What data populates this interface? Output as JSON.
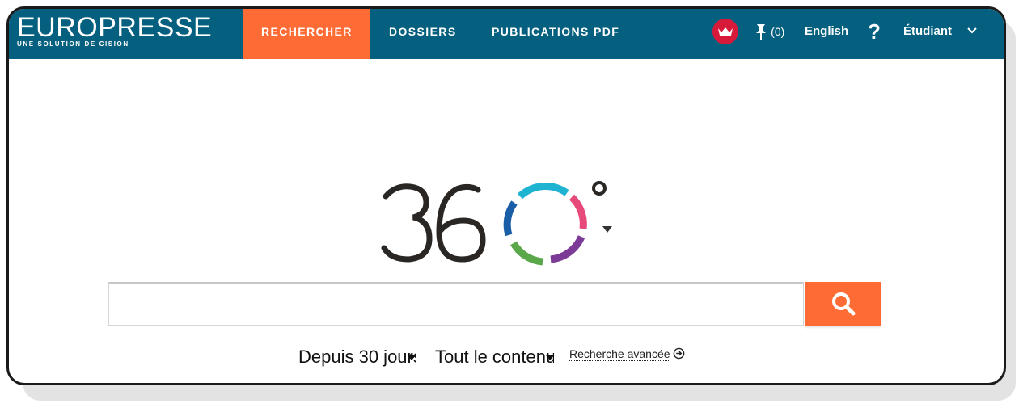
{
  "brand": {
    "name": "EUROPRESSE",
    "tagline": "UNE SOLUTION DE CISION"
  },
  "nav": [
    {
      "label": "RECHERCHER",
      "active": true
    },
    {
      "label": "DOSSIERS",
      "active": false
    },
    {
      "label": "PUBLICATIONS PDF",
      "active": false
    }
  ],
  "header_right": {
    "pin_count": "(0)",
    "language": "English",
    "help": "?",
    "user": "Étudiant"
  },
  "search": {
    "value": "",
    "placeholder": ""
  },
  "filters": {
    "period": "Depuis 30 jours",
    "content": "Tout le contenu"
  },
  "advanced_search_label": "Recherche avancée",
  "colors": {
    "topbar": "#05607f",
    "accent": "#ff6b35",
    "flag": "#d7193a",
    "ring": [
      "#1fb3d2",
      "#e74a7a",
      "#7b3b96",
      "#5aa84a",
      "#1b5ea8"
    ]
  }
}
